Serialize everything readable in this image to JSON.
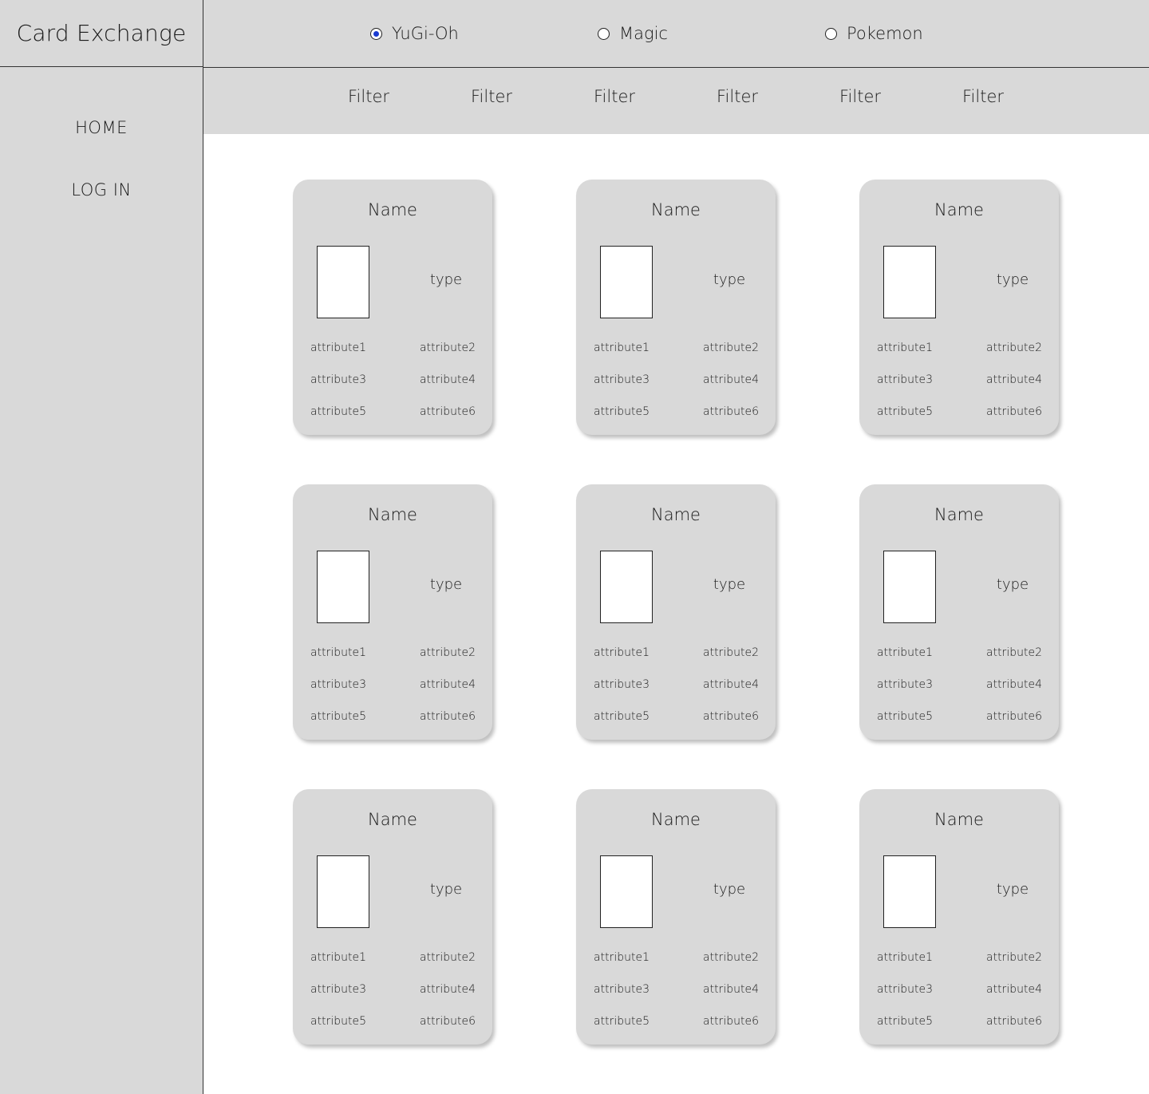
{
  "sidebar": {
    "brand": "Card Exchange",
    "nav": [
      {
        "label": "HOME"
      },
      {
        "label": "LOG IN"
      }
    ]
  },
  "game_selector": {
    "options": [
      {
        "label": "YuGi-Oh",
        "checked": true
      },
      {
        "label": "Magic",
        "checked": false
      },
      {
        "label": "Pokemon",
        "checked": false
      }
    ],
    "accent_color": "#1a3bd1"
  },
  "filters": [
    {
      "label": "Filter"
    },
    {
      "label": "Filter"
    },
    {
      "label": "Filter"
    },
    {
      "label": "Filter"
    },
    {
      "label": "Filter"
    },
    {
      "label": "Filter"
    }
  ],
  "cards": [
    {
      "name": "Name",
      "type": "type",
      "attributes": [
        "attribute1",
        "attribute2",
        "attribute3",
        "attribute4",
        "attribute5",
        "attribute6"
      ]
    },
    {
      "name": "Name",
      "type": "type",
      "attributes": [
        "attribute1",
        "attribute2",
        "attribute3",
        "attribute4",
        "attribute5",
        "attribute6"
      ]
    },
    {
      "name": "Name",
      "type": "type",
      "attributes": [
        "attribute1",
        "attribute2",
        "attribute3",
        "attribute4",
        "attribute5",
        "attribute6"
      ]
    },
    {
      "name": "Name",
      "type": "type",
      "attributes": [
        "attribute1",
        "attribute2",
        "attribute3",
        "attribute4",
        "attribute5",
        "attribute6"
      ]
    },
    {
      "name": "Name",
      "type": "type",
      "attributes": [
        "attribute1",
        "attribute2",
        "attribute3",
        "attribute4",
        "attribute5",
        "attribute6"
      ]
    },
    {
      "name": "Name",
      "type": "type",
      "attributes": [
        "attribute1",
        "attribute2",
        "attribute3",
        "attribute4",
        "attribute5",
        "attribute6"
      ]
    },
    {
      "name": "Name",
      "type": "type",
      "attributes": [
        "attribute1",
        "attribute2",
        "attribute3",
        "attribute4",
        "attribute5",
        "attribute6"
      ]
    },
    {
      "name": "Name",
      "type": "type",
      "attributes": [
        "attribute1",
        "attribute2",
        "attribute3",
        "attribute4",
        "attribute5",
        "attribute6"
      ]
    },
    {
      "name": "Name",
      "type": "type",
      "attributes": [
        "attribute1",
        "attribute2",
        "attribute3",
        "attribute4",
        "attribute5",
        "attribute6"
      ]
    }
  ]
}
